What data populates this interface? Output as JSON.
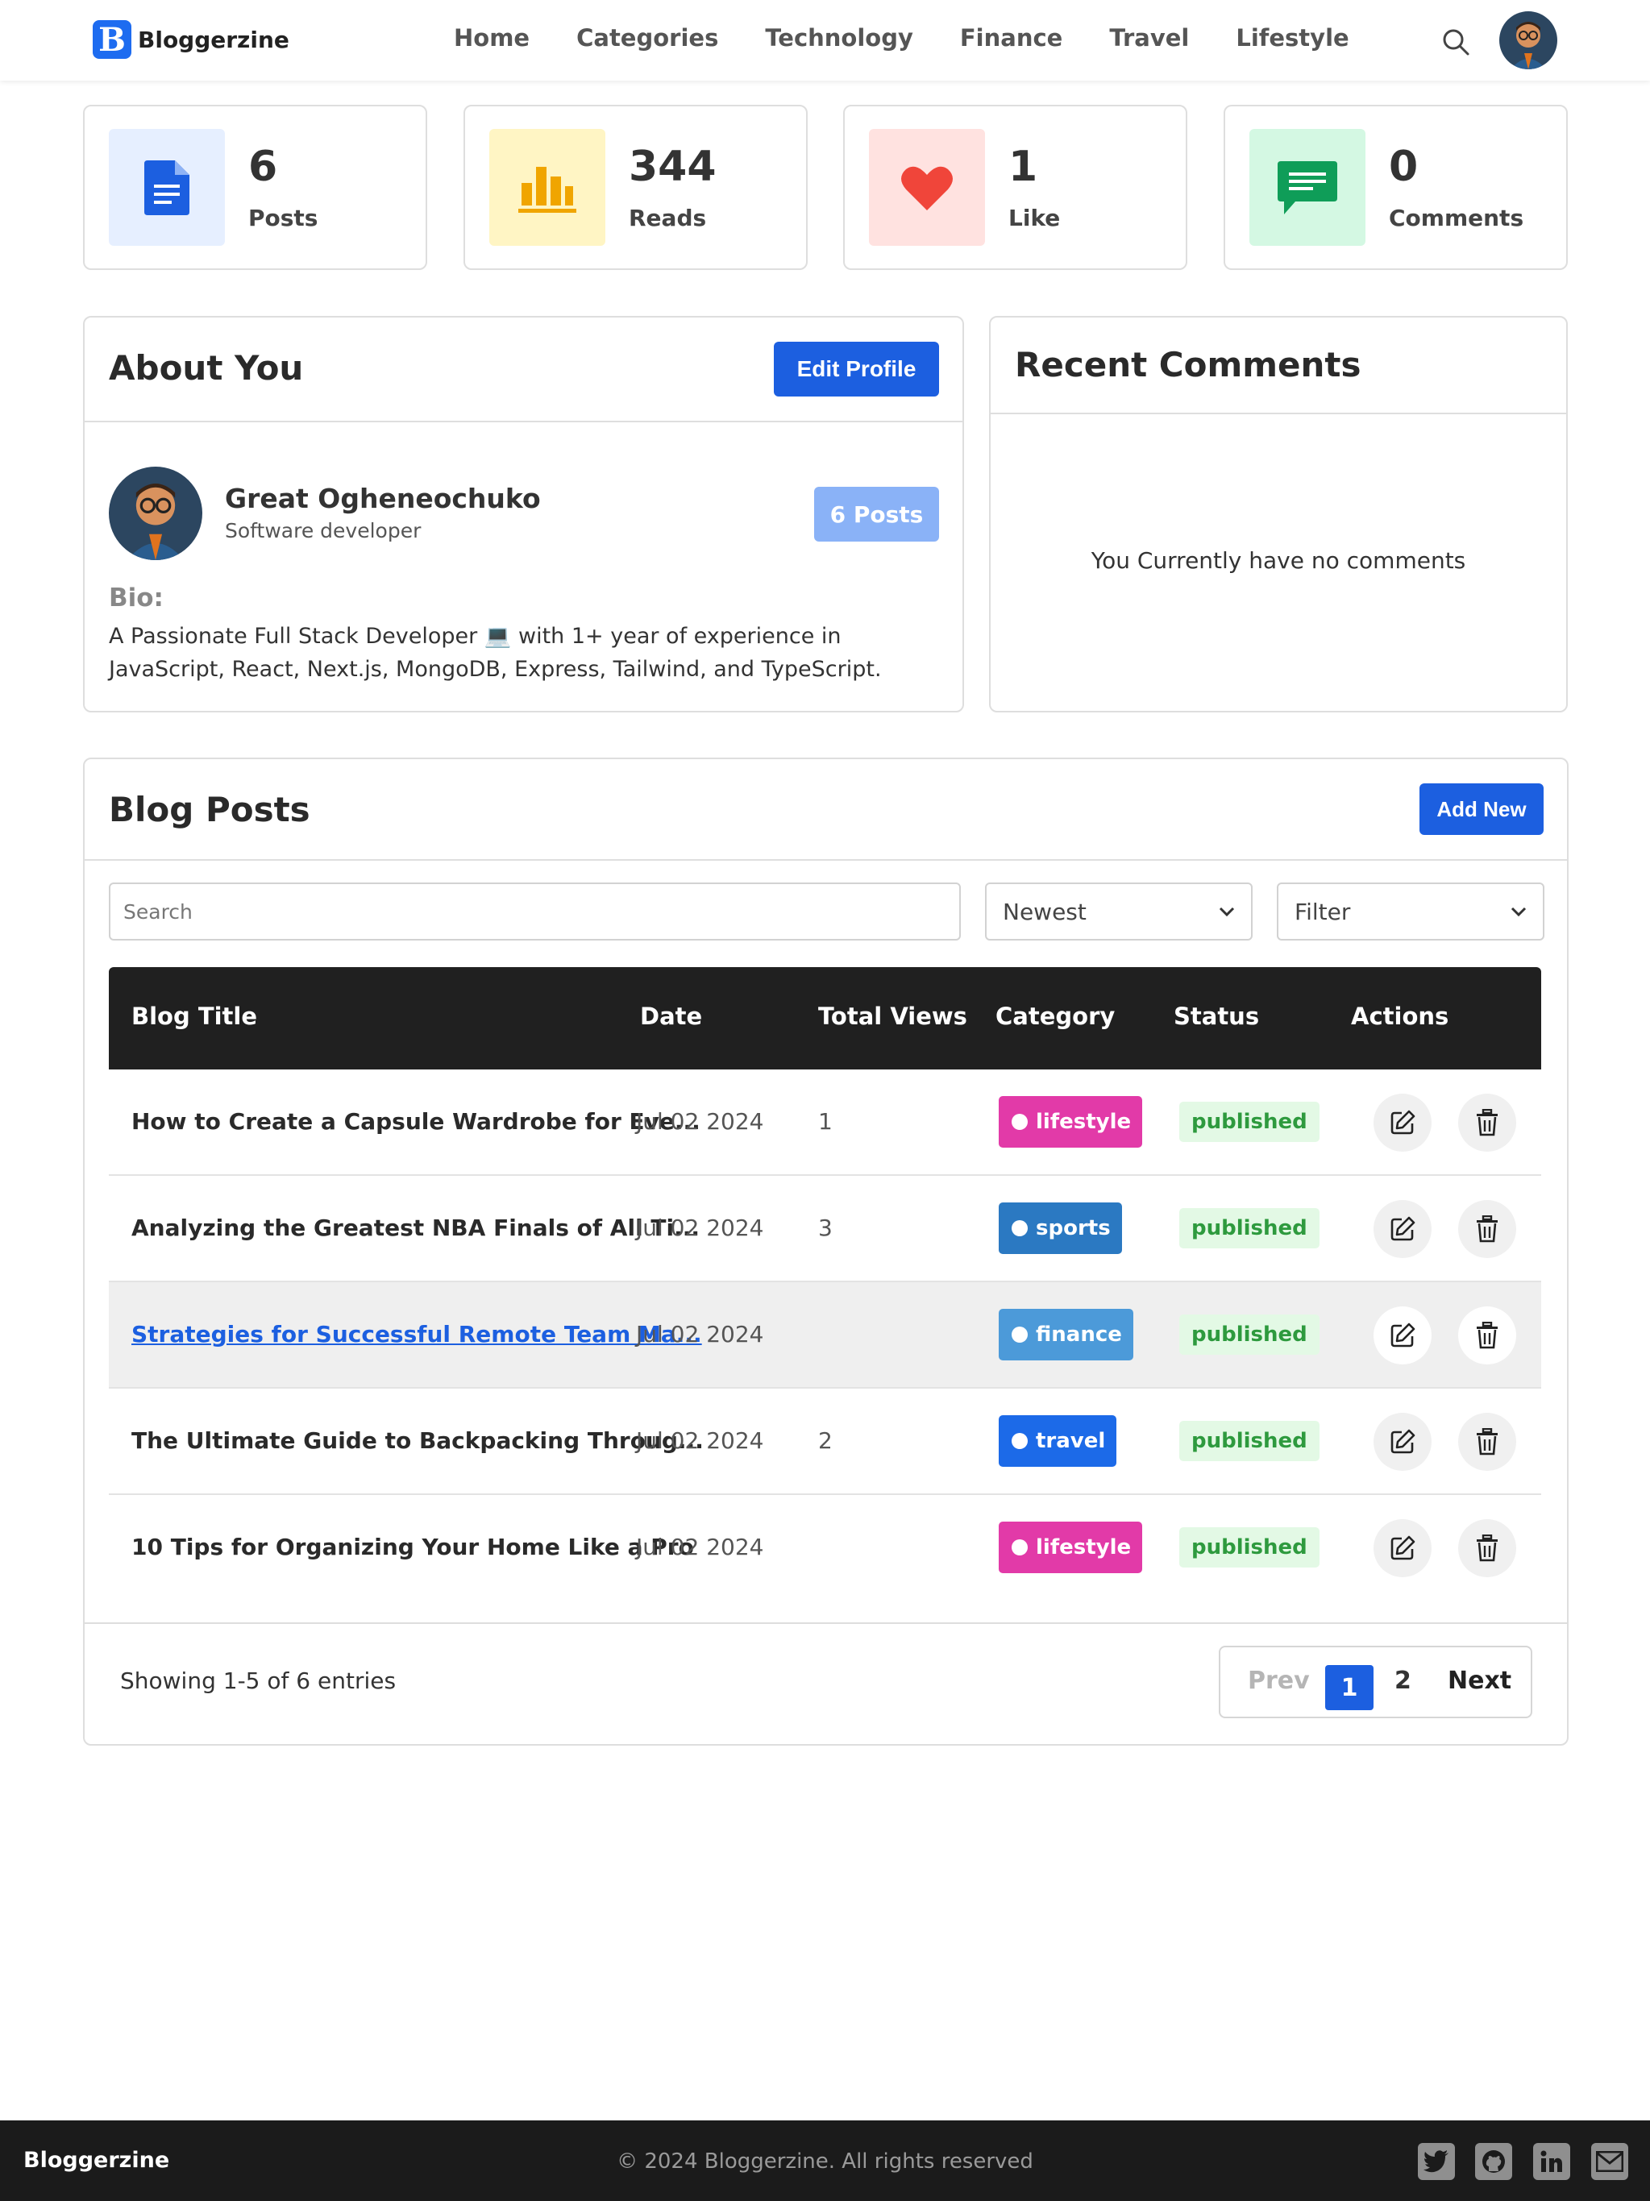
{
  "brand": {
    "logo_letter": "B",
    "name": "Bloggerzine"
  },
  "nav": [
    "Home",
    "Categories",
    "Technology",
    "Finance",
    "Travel",
    "Lifestyle"
  ],
  "stats": [
    {
      "value": "6",
      "label": "Posts",
      "icon": "document-icon",
      "bg": "#e6efff",
      "color": "#1c5fe0"
    },
    {
      "value": "344",
      "label": "Reads",
      "icon": "bar-chart-icon",
      "bg": "#fff5c4",
      "color": "#f0a500"
    },
    {
      "value": "1",
      "label": "Like",
      "icon": "heart-icon",
      "bg": "#ffe2e0",
      "color": "#f0453a"
    },
    {
      "value": "0",
      "label": "Comments",
      "icon": "chat-icon",
      "bg": "#d4f8e3",
      "color": "#0f9d58"
    }
  ],
  "about": {
    "title": "About You",
    "edit_label": "Edit Profile",
    "name": "Great Ogheneochuko",
    "role": "Software developer",
    "posts_badge": "6 Posts",
    "bio_label": "Bio:",
    "bio": "A Passionate Full Stack Developer 💻 with 1+ year of experience in JavaScript, React, Next.js, MongoDB, Express, Tailwind, and TypeScript."
  },
  "comments": {
    "title": "Recent Comments",
    "empty": "You Currently have no comments"
  },
  "blog": {
    "title": "Blog Posts",
    "add_label": "Add New",
    "search_placeholder": "Search",
    "sort_value": "Newest",
    "filter_value": "Filter",
    "columns": [
      "Blog Title",
      "Date",
      "Total Views",
      "Category",
      "Status",
      "Actions"
    ],
    "rows": [
      {
        "title": "How to Create a Capsule Wardrobe for Eve...",
        "date": "Jul 02 2024",
        "views": "1",
        "category": "lifestyle",
        "cat_color": "#e23aa8",
        "status": "published"
      },
      {
        "title": "Analyzing the Greatest NBA Finals of All Ti...",
        "date": "Jul 02 2024",
        "views": "3",
        "category": "sports",
        "cat_color": "#2b79c2",
        "status": "published"
      },
      {
        "title": "Strategies for Successful Remote Team Ma...",
        "date": "Jul 02 2024",
        "views": "",
        "category": "finance",
        "cat_color": "#4c9ad9",
        "status": "published"
      },
      {
        "title": "The Ultimate Guide to Backpacking Throug...",
        "date": "Jul 02 2024",
        "views": "2",
        "category": "travel",
        "cat_color": "#1c6ae8",
        "status": "published"
      },
      {
        "title": "10 Tips for Organizing Your Home Like a Pro",
        "date": "Jul 02 2024",
        "views": "",
        "category": "lifestyle",
        "cat_color": "#e23aa8",
        "status": "published"
      }
    ],
    "showing": "Showing 1-5 of 6 entries",
    "pager": {
      "prev": "Prev",
      "page1": "1",
      "page2": "2",
      "next": "Next"
    }
  },
  "footer": {
    "brand": "Bloggerzine",
    "copyright": "© 2024 Bloggerzine. All rights reserved",
    "social": [
      "twitter-icon",
      "github-icon",
      "linkedin-icon",
      "mail-icon"
    ]
  }
}
